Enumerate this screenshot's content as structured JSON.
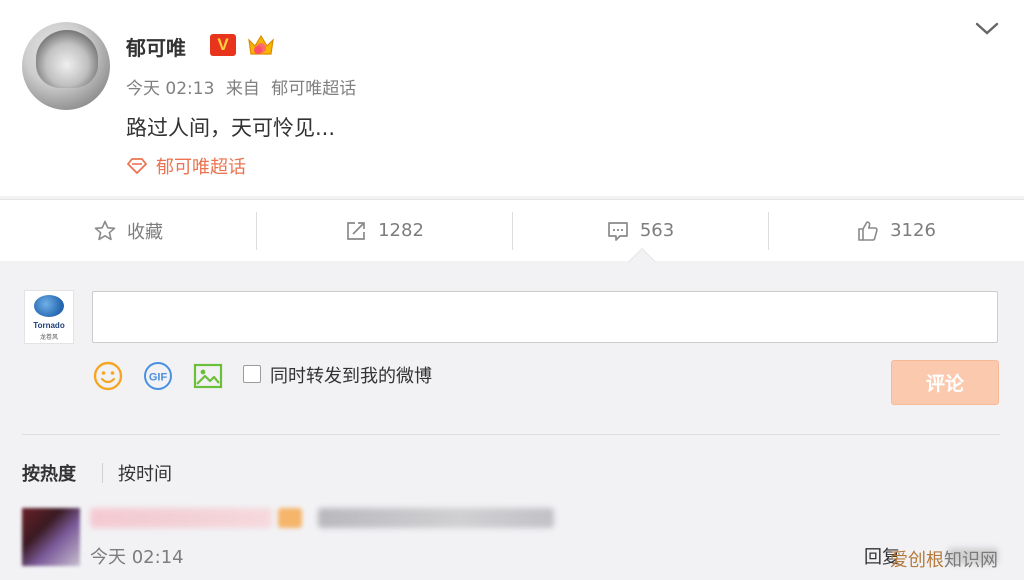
{
  "post": {
    "author": "郁可唯",
    "verified_label": "V",
    "time": "今天 02:13",
    "source_prefix": "来自",
    "source": "郁可唯超话",
    "content": "路过人间，天可怜见...",
    "topic": "郁可唯超话"
  },
  "actions": {
    "favorite_label": "收藏",
    "repost_count": "1282",
    "comment_count": "563",
    "like_count": "3126"
  },
  "comment_box": {
    "avatar_brand": "Tornado",
    "avatar_sub": "龙卷风",
    "input_value": "",
    "repost_label": "同时转发到我的微博",
    "submit_label": "评论"
  },
  "sort": {
    "hot_label": "按热度",
    "time_label": "按时间"
  },
  "first_comment": {
    "time": "今天 02:14",
    "reply_label": "回复"
  },
  "watermark": {
    "highlight": "爱创根",
    "rest": "知识网"
  },
  "colors": {
    "accent_orange": "#eb7350",
    "submit_disabled": "#fbc9ad",
    "verified_red": "#e8341c"
  }
}
